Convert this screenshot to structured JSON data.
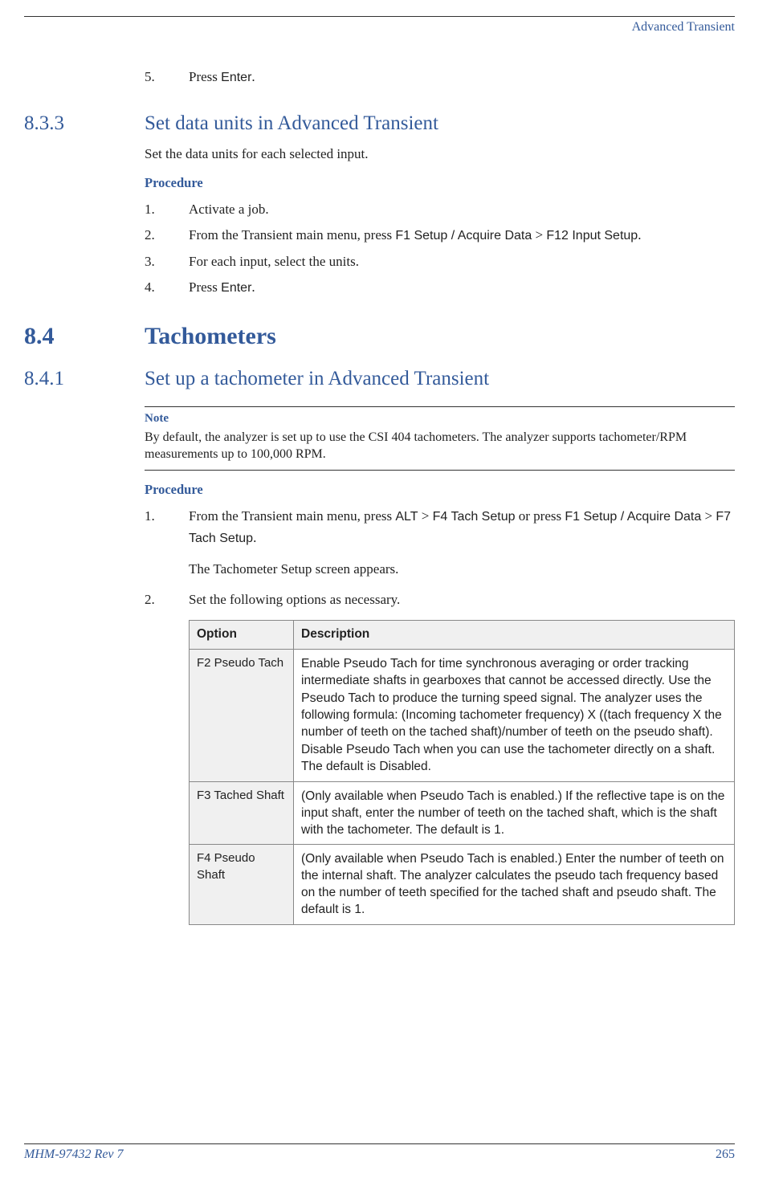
{
  "header": {
    "running_title": "Advanced Transient"
  },
  "pre_step": {
    "num": "5.",
    "text_a": "Press ",
    "ui": "Enter",
    "text_b": "."
  },
  "s833": {
    "num": "8.3.3",
    "title": "Set data units in Advanced Transient",
    "intro": "Set the data units for each selected input.",
    "procedure_label": "Procedure",
    "steps": [
      {
        "num": "1.",
        "plain": "Activate a job."
      },
      {
        "num": "2.",
        "a": "From the Transient main menu, press ",
        "ui1": "F1 Setup / Acquire Data",
        "mid": " > ",
        "ui2": "F12 Input Setup",
        "b": "."
      },
      {
        "num": "3.",
        "plain": "For each input, select the units."
      },
      {
        "num": "4.",
        "a": "Press ",
        "ui1": "Enter",
        "b": "."
      }
    ]
  },
  "s84": {
    "num": "8.4",
    "title": "Tachometers"
  },
  "s841": {
    "num": "8.4.1",
    "title": "Set up a tachometer in Advanced Transient",
    "note_label": "Note",
    "note_body": "By default, the analyzer is set up to use the CSI 404 tachometers. The analyzer supports tachometer/RPM measurements up to 100,000 RPM.",
    "procedure_label": "Procedure",
    "step1": {
      "num": "1.",
      "a": "From the Transient main menu, press ",
      "ui1": "ALT",
      "mid1": " > ",
      "ui2": "F4 Tach Setup",
      "mid2": " or press ",
      "ui3": "F1 Setup / Acquire Data",
      "mid3": " > ",
      "ui4": "F7 Tach Setup",
      "b": ".",
      "sub": "The Tachometer Setup screen appears."
    },
    "step2": {
      "num": "2.",
      "text": "Set the following options as necessary."
    },
    "table": {
      "head_option": "Option",
      "head_desc": "Description",
      "rows": [
        {
          "opt": "F2 Pseudo Tach",
          "d_a": "Enable ",
          "d_ui1": "Pseudo Tach",
          "d_b": " for time synchronous averaging or order tracking intermediate shafts in gearboxes that cannot be accessed directly. Use the ",
          "d_ui2": "Pseudo Tach",
          "d_c": " to produce the turning speed signal. The analyzer uses the following formula: (Incoming tachometer frequency) X ((tach frequency X the number of teeth on the tached shaft)/number of teeth on the pseudo shaft). Disable ",
          "d_ui3": "Pseudo Tach",
          "d_d": " when you can use the tachometer directly on a shaft. The default is Disabled."
        },
        {
          "opt": "F3 Tached Shaft",
          "d_a": "(Only available when ",
          "d_ui1": "Pseudo Tach",
          "d_b": " is enabled.) If the reflective tape is on the input shaft, enter the number of teeth on the tached shaft, which is the shaft with the tachometer. The default is 1."
        },
        {
          "opt": "F4 Pseudo Shaft",
          "d_a": "(Only available when ",
          "d_ui1": "Pseudo Tach",
          "d_b": " is enabled.) Enter the number of teeth on the internal shaft. The analyzer calculates the pseudo tach frequency based on the number of teeth specified for the tached shaft and pseudo shaft. The default is 1."
        }
      ]
    }
  },
  "footer": {
    "doc_id": "MHM-97432 Rev 7",
    "page": "265"
  }
}
